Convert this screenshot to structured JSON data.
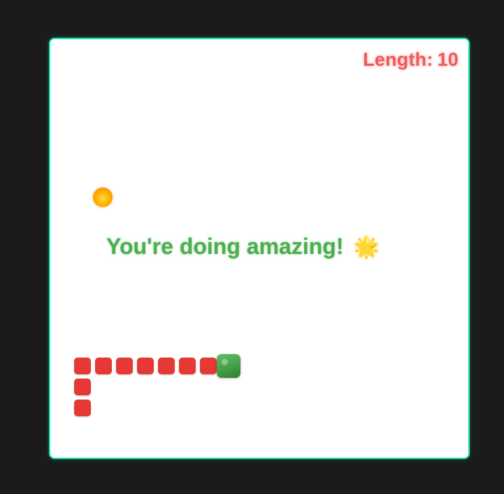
{
  "hud": {
    "length_label": "Length:",
    "length_value": "10"
  },
  "message": {
    "text": "You're doing amazing!",
    "emoji": "🌟"
  },
  "colors": {
    "background": "#1b1b1b",
    "board": "#ffffff",
    "board_border": "#1de9b6",
    "snake_body": "#e53935",
    "snake_head": "#43a047",
    "food": "#ffb300",
    "score_text": "#f05a5a",
    "message_text": "#4caf50"
  },
  "snake": {
    "length": 10
  }
}
